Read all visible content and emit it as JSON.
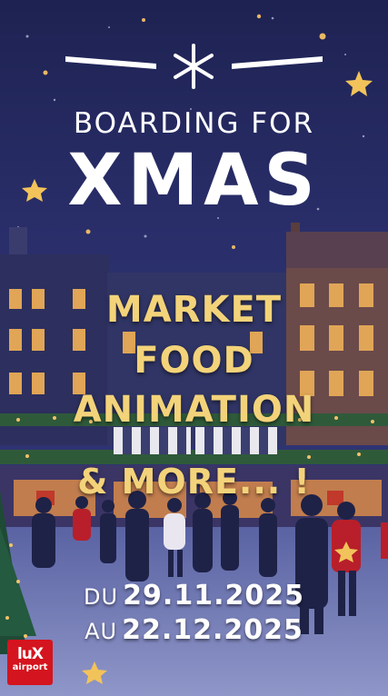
{
  "title": {
    "line1": "BOARDING FOR",
    "line2": "XMAS"
  },
  "highlights": [
    "MARKET",
    "FOOD",
    "ANIMATION",
    "& MORE... !"
  ],
  "dates": {
    "from_prefix": "DU",
    "from_date": "29.11.2025",
    "to_prefix": "AU",
    "to_date": "22.12.2025"
  },
  "logo": {
    "line1": "luX",
    "line2": "airport"
  },
  "colors": {
    "accent_gold": "#f3d37a",
    "background_navy": "#2a2f6b",
    "logo_red": "#d4141e"
  }
}
